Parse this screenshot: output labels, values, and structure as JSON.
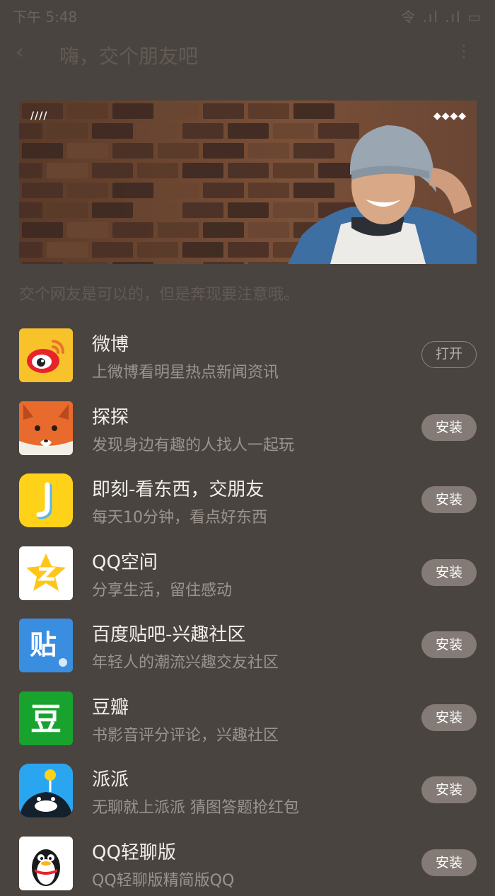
{
  "status_bar": {
    "time": "下午 5:48",
    "right": "令 .ıl .ıl ▭"
  },
  "header": {
    "back_glyph": "‹",
    "title": "嗨，交个朋友吧",
    "more_glyph": "⋮"
  },
  "banner": {
    "left_indicator": "////",
    "right_indicator": "◆◆◆◆"
  },
  "subtitle": "交个网友是可以的，但是奔现要注意哦。",
  "apps": [
    {
      "name": "微博",
      "desc": "上微博看明星热点新闻资讯",
      "action": "打开",
      "icon": "weibo-icon"
    },
    {
      "name": "探探",
      "desc": "发现身边有趣的人找人一起玩",
      "action": "安装",
      "icon": "tantan-fox-icon"
    },
    {
      "name": "即刻-看东西，交朋友",
      "desc": "每天10分钟，看点好东西",
      "action": "安装",
      "icon": "jike-icon"
    },
    {
      "name": "QQ空间",
      "desc": "分享生活，留住感动",
      "action": "安装",
      "icon": "qzone-star-icon"
    },
    {
      "name": "百度贴吧-兴趣社区",
      "desc": "年轻人的潮流兴趣交友社区",
      "action": "安装",
      "icon": "tieba-icon"
    },
    {
      "name": "豆瓣",
      "desc": "书影音评分评论，兴趣社区",
      "action": "安装",
      "icon": "douban-icon"
    },
    {
      "name": "派派",
      "desc": "无聊就上派派 猜图答题抢红包",
      "action": "安装",
      "icon": "paipai-whale-icon"
    },
    {
      "name": "QQ轻聊版",
      "desc": "QQ轻聊版精简版QQ",
      "action": "安装",
      "icon": "qq-penguin-icon"
    }
  ],
  "icon_glyphs": {
    "jike": "J",
    "tieba": "贴",
    "douban": "豆"
  },
  "colors": {
    "background": "#4a4440",
    "install_button": "#847b76",
    "tieba_blue": "#3a8ee0",
    "douban_green": "#17a32e",
    "jike_yellow": "#ffd21a",
    "paipai_blue": "#2aa6f0"
  }
}
